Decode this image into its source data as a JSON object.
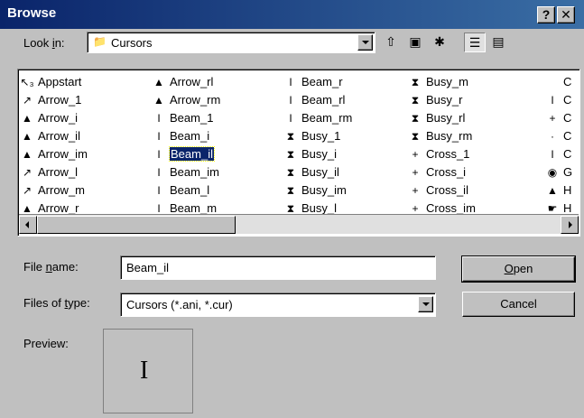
{
  "window": {
    "title": "Browse",
    "help_label": "?",
    "close_label": "✕"
  },
  "lookin": {
    "label_pre": "Look ",
    "label_ul": "i",
    "label_post": "n:",
    "value": "Cursors"
  },
  "toolbar": {
    "up_icon": "folder-up-icon",
    "desktop_icon": "desktop-icon",
    "newfolder_icon": "new-folder-icon",
    "list_icon": "list-view-icon",
    "details_icon": "details-view-icon"
  },
  "files": {
    "col1": [
      {
        "icon": "↖₃",
        "name": "Appstart"
      },
      {
        "icon": "↗",
        "name": "Arrow_1"
      },
      {
        "icon": "▲",
        "name": "Arrow_i"
      },
      {
        "icon": "▲",
        "name": "Arrow_il"
      },
      {
        "icon": "▲",
        "name": "Arrow_im"
      },
      {
        "icon": "↗",
        "name": "Arrow_l"
      },
      {
        "icon": "↗",
        "name": "Arrow_m"
      },
      {
        "icon": "▲",
        "name": "Arrow_r"
      }
    ],
    "col2": [
      {
        "icon": "▲",
        "name": "Arrow_rl"
      },
      {
        "icon": "▲",
        "name": "Arrow_rm"
      },
      {
        "icon": "I",
        "name": "Beam_1"
      },
      {
        "icon": "I",
        "name": "Beam_i"
      },
      {
        "icon": "I",
        "name": "Beam_il",
        "selected": true
      },
      {
        "icon": "I",
        "name": "Beam_im"
      },
      {
        "icon": "I",
        "name": "Beam_l"
      },
      {
        "icon": "I",
        "name": "Beam_m"
      }
    ],
    "col3": [
      {
        "icon": "I",
        "name": "Beam_r"
      },
      {
        "icon": "I",
        "name": "Beam_rl"
      },
      {
        "icon": "I",
        "name": "Beam_rm"
      },
      {
        "icon": "⧗",
        "name": "Busy_1"
      },
      {
        "icon": "⧗",
        "name": "Busy_i"
      },
      {
        "icon": "⧗",
        "name": "Busy_il"
      },
      {
        "icon": "⧗",
        "name": "Busy_im"
      },
      {
        "icon": "⧗",
        "name": "Busy_l"
      }
    ],
    "col4": [
      {
        "icon": "⧗",
        "name": "Busy_m"
      },
      {
        "icon": "⧗",
        "name": "Busy_r"
      },
      {
        "icon": "⧗",
        "name": "Busy_rl"
      },
      {
        "icon": "⧗",
        "name": "Busy_rm"
      },
      {
        "icon": "+",
        "name": "Cross_1"
      },
      {
        "icon": "+",
        "name": "Cross_i"
      },
      {
        "icon": "+",
        "name": "Cross_il"
      },
      {
        "icon": "+",
        "name": "Cross_im"
      }
    ],
    "col5": [
      {
        "icon": "",
        "name": "C"
      },
      {
        "icon": "I",
        "name": "C"
      },
      {
        "icon": "+",
        "name": "C"
      },
      {
        "icon": "·",
        "name": "C"
      },
      {
        "icon": "I",
        "name": "C"
      },
      {
        "icon": "◉",
        "name": "G"
      },
      {
        "icon": "▲",
        "name": "H"
      },
      {
        "icon": "☛",
        "name": "H"
      }
    ]
  },
  "filename": {
    "label_pre": "File ",
    "label_ul": "n",
    "label_post": "ame:",
    "value": "Beam_il"
  },
  "filetype": {
    "label_pre": "Files of ",
    "label_ul": "t",
    "label_post": "ype:",
    "value": "Cursors (*.ani, *.cur)"
  },
  "buttons": {
    "open_ul": "O",
    "open_rest": "pen",
    "cancel": "Cancel"
  },
  "preview": {
    "label": "Preview:",
    "glyph": "I"
  }
}
